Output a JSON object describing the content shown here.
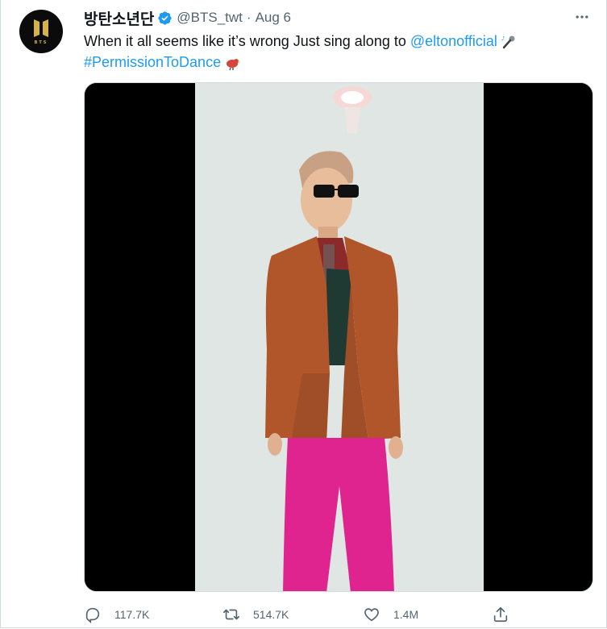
{
  "tweet": {
    "author_name": "방탄소년단",
    "handle": "@BTS_twt",
    "separator": "·",
    "date": "Aug 6",
    "text_plain": "When it all seems like it’s wrong Just sing along to ",
    "mention": "@eltonofficial",
    "hashtag": "#PermissionToDance",
    "avatar_label": "BTS"
  },
  "actions": {
    "replies": "117.7K",
    "retweets": "514.7K",
    "likes": "1.4M"
  },
  "colors": {
    "link": "#1d9bf0",
    "verified": "#1d9bf0",
    "muted": "#536471",
    "jacket": "#b0562a",
    "pants": "#e0248f"
  },
  "icons": [
    "verified-badge-icon",
    "more-options-icon",
    "microphone-icon",
    "bird-emoji-icon",
    "reply-icon",
    "retweet-icon",
    "like-icon",
    "share-icon"
  ]
}
